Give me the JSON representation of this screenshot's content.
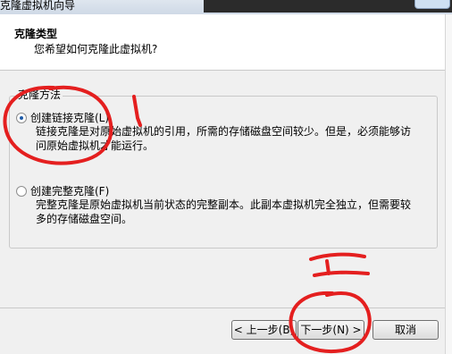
{
  "window": {
    "title": "克隆虚拟机向导"
  },
  "header": {
    "title": "克隆类型",
    "subtitle": "您希望如何克隆此虚拟机?"
  },
  "group": {
    "legend": "克隆方法"
  },
  "options": [
    {
      "label": "创建链接克隆(L)",
      "selected": true,
      "description": "链接克隆是对原始虚拟机的引用，所需的存储磁盘空间较少。但是，必须能够访问原始虚拟机才能运行。"
    },
    {
      "label": "创建完整克隆(F)",
      "selected": false,
      "description": "完整克隆是原始虚拟机当前状态的完整副本。此副本虚拟机完全独立，但需要较多的存储磁盘空间。"
    }
  ],
  "buttons": {
    "prev": "< 上一步(B)",
    "next": "下一步(N) >",
    "cancel": "取消"
  },
  "annotations": {
    "mark_1": "1",
    "mark_2": "2",
    "color": "#e41f1f"
  }
}
